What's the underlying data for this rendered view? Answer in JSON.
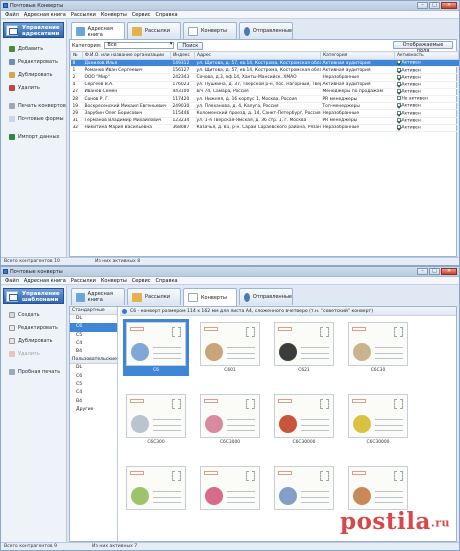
{
  "window1": {
    "title": "Почтовые Конверты",
    "menu": [
      "Файл",
      "Адресная книга",
      "Рассылки",
      "Конверты",
      "Сервис",
      "Справка"
    ],
    "sidebar_header": "Управление адресатами",
    "sidebar_buttons": [
      {
        "label": "Добавить",
        "enabled": true
      },
      {
        "label": "Редактировать",
        "enabled": true
      },
      {
        "label": "Дублировать",
        "enabled": true
      },
      {
        "label": "Удалить",
        "enabled": true
      },
      {
        "label": "Печать конвертов",
        "enabled": true
      },
      {
        "label": "Почтовые формы",
        "enabled": true
      },
      {
        "label": "Импорт данных",
        "enabled": true
      }
    ],
    "tabs": [
      "Адресная книга",
      "Рассылки",
      "Конверты",
      "Отправленные"
    ],
    "active_tab": 0,
    "filter_label": "Категория:",
    "filter_value": "Все",
    "search_button": "Поиск",
    "fields_button": "Отображаемые поля",
    "columns": [
      "№",
      "Ф.И.О. или название организации",
      "Индекс",
      "Адрес",
      "Категория",
      "Активность"
    ],
    "rows": [
      {
        "n": "8",
        "name": "Данилов Илья",
        "index": "149312",
        "address": "ул. Щитова, д. 57, кв.14, Кострома, Костромская область",
        "category": "Активная аудитория",
        "active": "Активен",
        "checked": true,
        "selected": true
      },
      {
        "n": "1",
        "name": "Романов Иван Сергеевич",
        "index": "156127",
        "address": "ул. Щитова, д. 57, кв.14, Кострома, Костромская область",
        "category": "Активная аудитория",
        "active": "Активен",
        "checked": true
      },
      {
        "n": "2",
        "name": "ООО \"Мир\"",
        "index": "242343",
        "address": "Сочова, д.3, оф.14, Ханты-Мансийск, ХМАО",
        "category": "Неразобранные",
        "active": "Активен",
        "checked": true
      },
      {
        "n": "4",
        "name": "Сергеев В.А.",
        "index": "176023",
        "address": "ул. Пушкина, д. 37, Тверской р-н, пос. Нагорный, Тверская область",
        "category": "Активная аудитория",
        "active": "Активен",
        "checked": true
      },
      {
        "n": "27",
        "name": "Иванов Семён",
        "index": "443100",
        "address": "в/ч 74, Самара, Россия",
        "category": "Менеджеры по продажам",
        "active": "Активен",
        "checked": true
      },
      {
        "n": "28",
        "name": "Сонов Р. Г.",
        "index": "117420",
        "address": "ул. Нижняя, д. 16 корпус 1, Москва, Россия",
        "category": "PR менеджеры",
        "active": "Не активен",
        "checked": false
      },
      {
        "n": "19",
        "name": "Воскресенский Михаил Евгеньевич",
        "index": "249030",
        "address": "ул. Плеханова, д. 4, Калуга, Россия",
        "category": "Топ-менеджеры",
        "active": "Активен",
        "checked": true
      },
      {
        "n": "29",
        "name": "Зарубин Олег Борисович",
        "index": "115446",
        "address": "Коломенский проезд, д. 14, Санкт-Петербург, Россия",
        "category": "Неразобранные",
        "active": "Активен",
        "checked": true
      },
      {
        "n": "31",
        "name": "Германов Владимир Михайлович",
        "index": "123234",
        "address": "ул. 1-я Тверская-Ямская, д. 36 стр. 1, г. Москва",
        "category": "PR менеджеры",
        "active": "Активен",
        "checked": true
      },
      {
        "n": "32",
        "name": "Никитина Мария Васильевна",
        "index": "368087",
        "address": "Казачья, д. 81, р-н. Сараи Сараевского района, Рязанская область",
        "category": "Неразобранные",
        "active": "Активен",
        "checked": true
      }
    ],
    "status_total": "Всего контрагентов 10",
    "status_active": "Из них активных 8"
  },
  "window2": {
    "title": "Почтовые конверты",
    "menu": [
      "Файл",
      "Адресная книга",
      "Рассылки",
      "Конверты",
      "Сервис",
      "Справка"
    ],
    "sidebar_header": "Управление шаблонами",
    "sidebar_buttons": [
      {
        "label": "Создать",
        "enabled": true
      },
      {
        "label": "Редактировать",
        "enabled": true
      },
      {
        "label": "Дублировать",
        "enabled": true
      },
      {
        "label": "Удалить",
        "enabled": false
      },
      {
        "label": "Пробная печать",
        "enabled": true
      }
    ],
    "tabs": [
      "Адресная книга",
      "Рассылки",
      "Конверты",
      "Отправленные"
    ],
    "active_tab": 2,
    "standard_label": "Стандартные",
    "standard_formats": [
      "DL",
      "C6",
      "C5",
      "C4",
      "B4"
    ],
    "selected_format": "C6",
    "custom_label": "Пользовательские",
    "custom_formats": [
      "DL",
      "C6",
      "C5",
      "C4",
      "B4",
      "Другие"
    ],
    "info_text": "C6 - конверт размером 114 х 162 мм для листа А4, сложенного вчетверо (т.н. \"советский\" конверт)",
    "templates": [
      {
        "caption": "C6",
        "accent": "#7fa7d8"
      },
      {
        "caption": "C601",
        "accent": "#c9a37a"
      },
      {
        "caption": "C621",
        "accent": "#3b3b3b"
      },
      {
        "caption": "C6C30",
        "accent": "#c9b48d"
      },
      {
        "caption": "C6C300",
        "accent": "#b9c4cf"
      },
      {
        "caption": "C6C3000",
        "accent": "#d98aa0"
      },
      {
        "caption": "C6C30000",
        "accent": "#c8543e"
      },
      {
        "caption": "C6C30000",
        "accent": "#d9c243"
      },
      {
        "caption": "",
        "accent": "#9dc46a"
      },
      {
        "caption": "",
        "accent": "#d86a8a"
      },
      {
        "caption": "",
        "accent": "#7fa0c8"
      },
      {
        "caption": "",
        "accent": "#c98a5a"
      }
    ],
    "status_total": "Всего контрагентов 9",
    "status_active": "Из них активных 7"
  },
  "watermark": {
    "main": "postila",
    "suffix": ".ru"
  }
}
